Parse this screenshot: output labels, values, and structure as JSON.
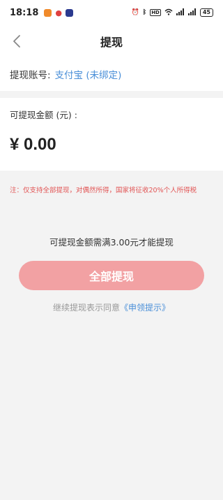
{
  "status_bar": {
    "time": "18:18",
    "battery": "45",
    "app_icons": [
      "orange-app-icon",
      "map-pin-icon",
      "blue-app-icon"
    ],
    "colors": {
      "orange": "#f08a2a",
      "pin": "#e04040",
      "blue": "#2b3a8f"
    }
  },
  "header": {
    "title": "提现"
  },
  "account": {
    "label": "提现账号:",
    "value": "支付宝 (未绑定)"
  },
  "balance": {
    "label": "可提现金额 (元) :",
    "amount": "¥ 0.00"
  },
  "notice": "注：仅支持全部提现，对偶然所得，国家将征收20%个人所得税",
  "minimum_note": "可提现金额需满3.00元才能提现",
  "withdraw_button": "全部提现",
  "agreement": {
    "prefix": "继续提现表示同意",
    "link": "《申领提示》"
  },
  "colors": {
    "accent_blue": "#4a8fd8",
    "notice_red": "#e25555",
    "button_pink": "#f2a1a3"
  }
}
